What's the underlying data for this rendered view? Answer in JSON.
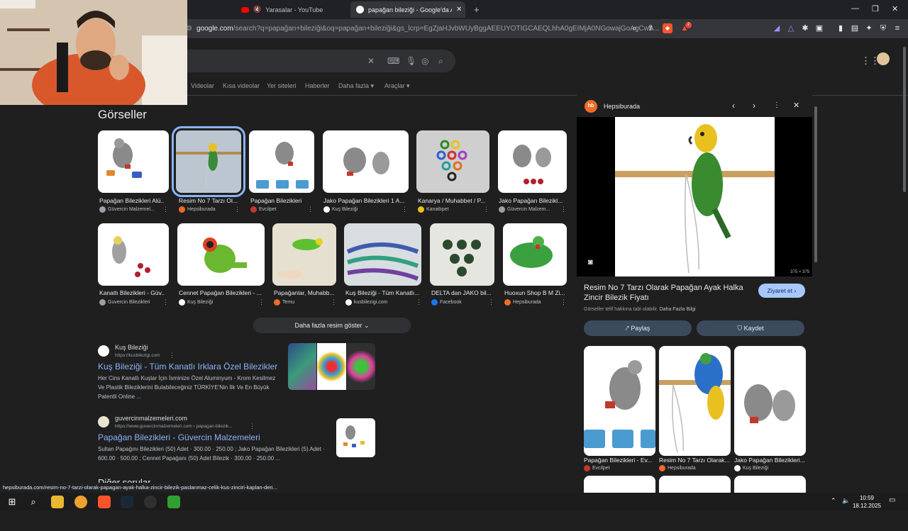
{
  "browser": {
    "tabs": [
      {
        "title": "Yarasalar - YouTube",
        "active": false
      },
      {
        "title": "papağan bileziği - Google'da Ar",
        "active": true
      }
    ],
    "new_tab": "+",
    "url_host": "google.com",
    "url_rest": "/search?q=papağan+bileziği&oq=papağan+bileziği&gs_lcrp=EgZjaHJvbWUyBggAEEUYOTIGCAEQLhhA0gEIMjA0NGowajGoAgCwA...",
    "badge_count": "2"
  },
  "search": {
    "tabs": [
      "Videolar",
      "Kısa videolar",
      "Yer siteleri",
      "Haberler",
      "Daha fazla",
      "Araçlar"
    ]
  },
  "images": {
    "heading": "Görseller",
    "row1": [
      {
        "caption": "Papağan Bilezikleri Alü...",
        "source": "Güvercin Malzemel..."
      },
      {
        "caption": "Resim No 7 Tarzı Ol...",
        "source": "Hepsiburada"
      },
      {
        "caption": "Papağan Bilezikleri",
        "source": "Evcilpet"
      },
      {
        "caption": "Jako Papağan Bilezikleri 1 A...",
        "source": "Kuş Bileziği"
      },
      {
        "caption": "Kanarya / Muhabbet / P...",
        "source": "Kanatlıpet"
      },
      {
        "caption": "Jako Papağan Bilezikl...",
        "source": "Güvercin Malzem..."
      }
    ],
    "row2": [
      {
        "caption": "Kanatlı Bilezikleri - Güv...",
        "source": "Guvercin Bilezikleri"
      },
      {
        "caption": "Cennet Papağan Bilezikleri - ...",
        "source": "Kuş Bileziği"
      },
      {
        "caption": "Papağanlar, Muhabb...",
        "source": "Temu"
      },
      {
        "caption": "Kuş Bileziği - Tüm Kanatlı...",
        "source": "kusbilezigi.com"
      },
      {
        "caption": "DELTA dan JAKO bil...",
        "source": "Facebook"
      },
      {
        "caption": "Huoxun Shop B M Zi...",
        "source": "Hepsiburada"
      }
    ],
    "more_button": "Daha fazla resim göster"
  },
  "results": [
    {
      "site": "Kuş Bileziği",
      "url": "https://kusbilezigi.com",
      "title": "Kuş Bileziği - Tüm Kanatlı Irklara Özel Bilezikler",
      "snippet": "Her Cins Kanatlı Kuşlar İçin İsminize Özel Aluminyum - Krom Kesilmez Ve Plastik Bileziklerini Bulabileceğiniz TÜRKİYE'Nin İlk Ve En Büyük Patentli Online ..."
    },
    {
      "site": "guvercinmalzemeleri.com",
      "url": "https://www.guvercinmalzemeleri.com › papagan-bilezik...",
      "title": "Papağan Bilezikleri - Güvercin Malzemeleri",
      "snippet": "Sultan Papağını Bilezikleri (50) Adet · 300.00 · 250.00 ; Jako Papağan Bilezikleri (5) Adet · 600.00 · 500.00 ; Cennet Papağanı (50) Adet Bilezik · 300.00 · 250.00 ..."
    }
  ],
  "next_section": "Diğer sorular",
  "panel": {
    "source": "Hepsiburada",
    "logo": "hb",
    "dimensions": "375 × 375",
    "heading": "Resim No 7 Tarzı Olarak Papağan Ayak Halka Zincir Bilezik Fiyatı",
    "visit": "Ziyaret et",
    "copyright": "Görseller telif hakkına tabi olabilir.",
    "learn_more": "Daha Fazla Bilgi",
    "share": "Paylaş",
    "save": "Kaydet",
    "related": [
      {
        "caption": "Papağan Bilezikleri - Ev...",
        "source": "Evcilpet"
      },
      {
        "caption": "Resim No 7 Tarzı Olarak...",
        "source": "Hepsiburada"
      },
      {
        "caption": "Jako Papağan Bilezikleri...",
        "source": "Kuş Bileziği"
      }
    ]
  },
  "status_url": "hepsiburada.com/resim-no-7-tarzi-olarak-papagan-ayak-halka-zincir-bilezik-paslanmaz-celik-kus-zinciri-kaplan-deri...",
  "taskbar": {
    "time": "10:59",
    "date": "18.12.2025"
  }
}
